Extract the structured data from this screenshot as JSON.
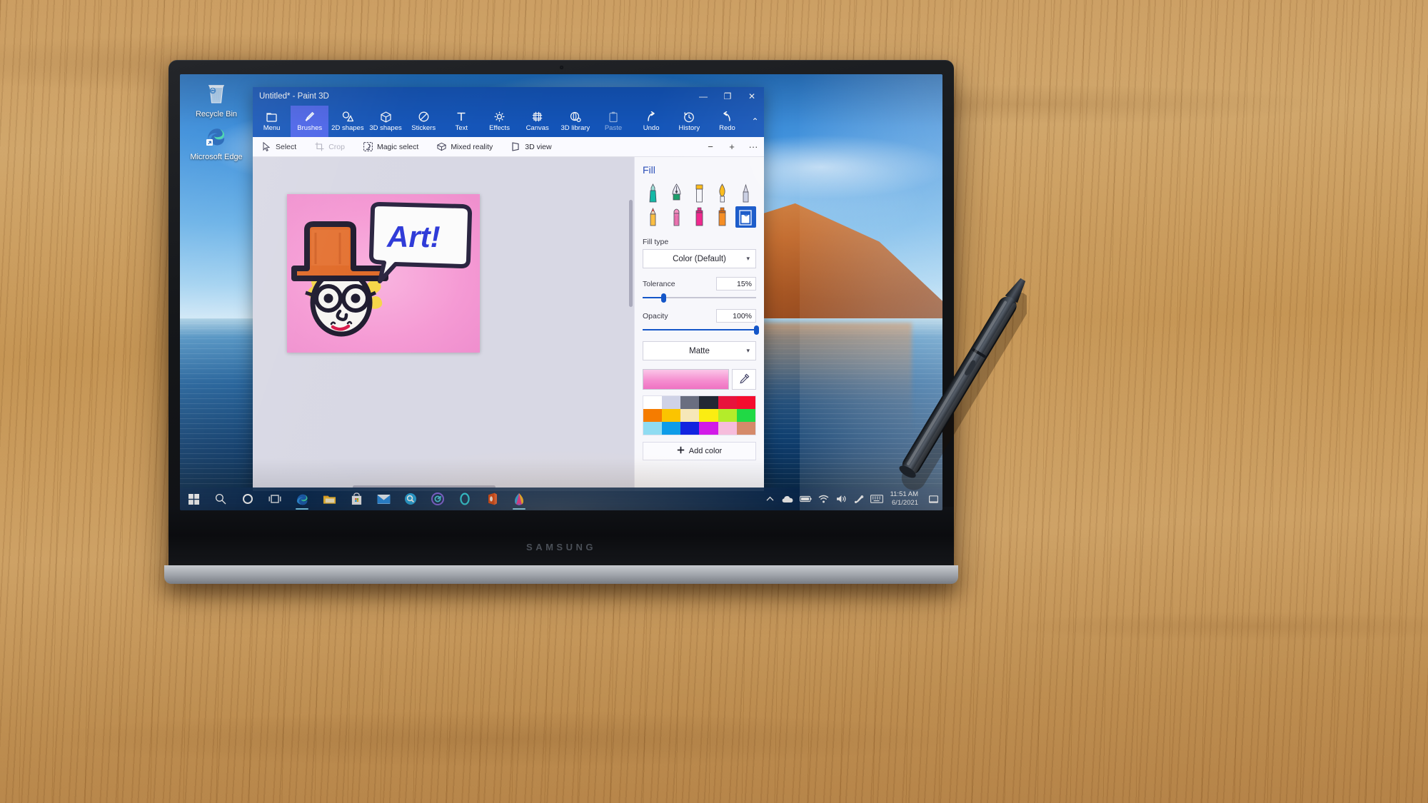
{
  "desktop": {
    "icons": [
      {
        "label": "Recycle Bin",
        "icon": "recycle-bin-icon"
      },
      {
        "label": "Microsoft Edge",
        "icon": "edge-icon"
      }
    ]
  },
  "device": {
    "brand": "SAMSUNG"
  },
  "paint3d": {
    "window_title": "Untitled* - Paint 3D",
    "window_controls": {
      "minimize": "—",
      "maximize": "❐",
      "close": "✕"
    },
    "ribbon": [
      {
        "label": "Menu",
        "icon": "folder-icon",
        "state": "normal"
      },
      {
        "label": "Brushes",
        "icon": "paintbrush-icon",
        "state": "active"
      },
      {
        "label": "2D shapes",
        "icon": "2d-shapes-icon",
        "state": "normal"
      },
      {
        "label": "3D shapes",
        "icon": "3d-cube-icon",
        "state": "normal"
      },
      {
        "label": "Stickers",
        "icon": "sticker-icon",
        "state": "normal"
      },
      {
        "label": "Text",
        "icon": "text-icon",
        "state": "normal"
      },
      {
        "label": "Effects",
        "icon": "effects-sun-icon",
        "state": "normal"
      },
      {
        "label": "Canvas",
        "icon": "canvas-frame-icon",
        "state": "normal"
      },
      {
        "label": "3D library",
        "icon": "3d-library-icon",
        "state": "normal"
      }
    ],
    "ribbon_right": [
      {
        "label": "Paste",
        "icon": "clipboard-paste-icon",
        "state": "dim"
      },
      {
        "label": "Undo",
        "icon": "undo-arrow-icon",
        "state": "normal"
      },
      {
        "label": "History",
        "icon": "history-clock-icon",
        "state": "normal"
      },
      {
        "label": "Redo",
        "icon": "redo-arrow-icon",
        "state": "normal"
      }
    ],
    "ribbon_collapse": "⌃",
    "subbar": [
      {
        "label": "Select",
        "icon": "cursor-select-icon",
        "disabled": false
      },
      {
        "label": "Crop",
        "icon": "crop-icon",
        "disabled": true
      },
      {
        "label": "Magic select",
        "icon": "magic-select-icon",
        "disabled": false
      },
      {
        "label": "Mixed reality",
        "icon": "mixed-reality-icon",
        "disabled": false
      },
      {
        "label": "3D view",
        "icon": "3d-view-icon",
        "disabled": false
      }
    ],
    "subbar_buttons": [
      {
        "label": "−",
        "name": "zoom-out-button"
      },
      {
        "label": "+",
        "name": "zoom-in-button"
      },
      {
        "label": "···",
        "name": "more-options-button"
      }
    ],
    "panel": {
      "title": "Fill",
      "brushes": [
        {
          "name": "marker-brush",
          "selected": false
        },
        {
          "name": "calligraphy-pen-brush",
          "selected": false
        },
        {
          "name": "oil-brush",
          "selected": false
        },
        {
          "name": "watercolor-brush",
          "selected": false
        },
        {
          "name": "eraser-tool",
          "selected": false
        },
        {
          "name": "pencil-brush",
          "selected": false
        },
        {
          "name": "crayon-brush",
          "selected": false
        },
        {
          "name": "spray-can-brush",
          "selected": false
        },
        {
          "name": "paint-can-brush",
          "selected": false
        },
        {
          "name": "fill-bucket-tool",
          "selected": true
        }
      ],
      "fill_type_label": "Fill type",
      "fill_type_value": "Color (Default)",
      "tolerance_label": "Tolerance",
      "tolerance_value": "15%",
      "tolerance_pct": 15,
      "opacity_label": "Opacity",
      "opacity_value": "100%",
      "opacity_pct": 100,
      "material_value": "Matte",
      "current_color": "#f58fd0",
      "eyedropper_icon": "eyedropper-icon",
      "swatches": [
        "#ffffff",
        "#cfd2e6",
        "#6a6e80",
        "#222834",
        "#e8123c",
        "#f50c2e",
        "#f57c00",
        "#fbc400",
        "#f6e7b8",
        "#fbed12",
        "#b4ec2a",
        "#20d945",
        "#8fdcf2",
        "#0e9ce8",
        "#1224e0",
        "#d21ae8",
        "#f6bcdc",
        "#d58a6a"
      ],
      "add_color_label": "Add color",
      "add_color_icon": "plus-icon"
    },
    "artwork": {
      "background_color": "#f59ad4",
      "speech_text": "Art!",
      "hat_color": "#e06a28",
      "hair_color": "#f5d648",
      "outline_color": "#1e1a2e",
      "ink_color": "#2e3ad8",
      "mouth_color": "#d81a4a"
    }
  },
  "taskbar": {
    "icons": [
      {
        "name": "start-button",
        "icon": "windows-logo-icon",
        "running": false
      },
      {
        "name": "search-button",
        "icon": "search-icon",
        "running": false
      },
      {
        "name": "cortana-button",
        "icon": "cortana-circle-icon",
        "running": false
      },
      {
        "name": "task-view-button",
        "icon": "task-view-icon",
        "running": false
      },
      {
        "name": "taskbar-edge",
        "icon": "edge-icon",
        "running": true
      },
      {
        "name": "taskbar-file-explorer",
        "icon": "file-explorer-icon",
        "running": false
      },
      {
        "name": "taskbar-microsoft-store",
        "icon": "microsoft-store-icon",
        "running": false
      },
      {
        "name": "taskbar-mail",
        "icon": "mail-icon",
        "running": false
      },
      {
        "name": "taskbar-quick-search",
        "icon": "quick-search-icon",
        "running": false
      },
      {
        "name": "taskbar-samsung-app",
        "icon": "samsung-circle-icon",
        "running": false
      },
      {
        "name": "taskbar-cortana-app",
        "icon": "cortana-ring-icon",
        "running": false
      },
      {
        "name": "taskbar-office",
        "icon": "office-icon",
        "running": false
      },
      {
        "name": "taskbar-paint3d",
        "icon": "paint3d-icon",
        "running": true
      }
    ],
    "tray": [
      {
        "name": "show-hidden-icons-button",
        "icon": "chevron-up-icon"
      },
      {
        "name": "onedrive-tray-icon",
        "icon": "cloud-icon"
      },
      {
        "name": "battery-tray-icon",
        "icon": "battery-icon"
      },
      {
        "name": "network-tray-icon",
        "icon": "wifi-icon"
      },
      {
        "name": "volume-tray-icon",
        "icon": "speaker-icon"
      },
      {
        "name": "pen-tray-icon",
        "icon": "pen-bluetooth-icon"
      },
      {
        "name": "touch-keyboard-button",
        "icon": "keyboard-icon"
      }
    ],
    "clock": {
      "time": "11:51 AM",
      "date": "6/1/2021"
    },
    "notification_icon": "action-center-icon"
  }
}
